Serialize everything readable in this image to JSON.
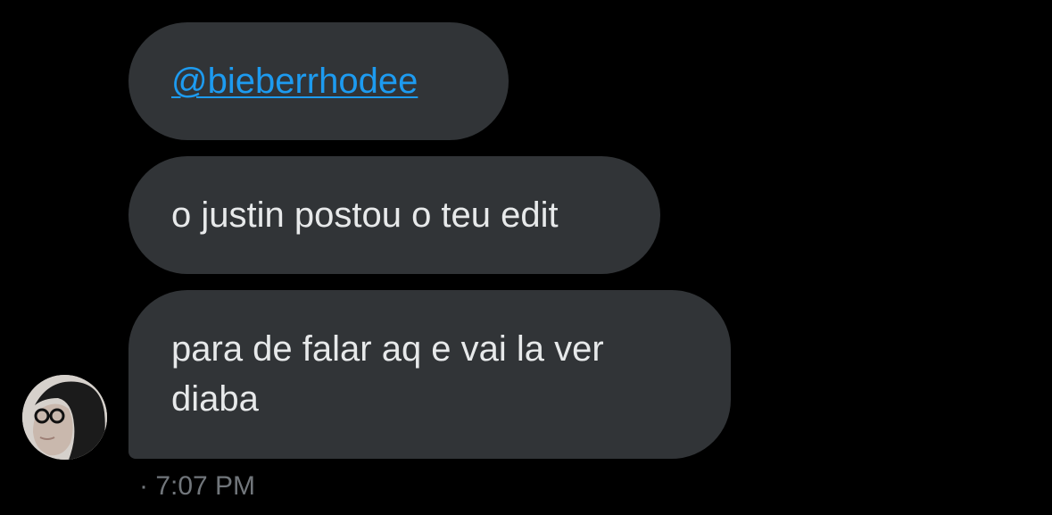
{
  "messages": [
    {
      "mention": "@bieberrhodee"
    },
    {
      "text": "o justin postou o teu edit"
    },
    {
      "text": "para de falar aq e vai la ver\ndiaba"
    }
  ],
  "timestamp": "· 7:07 PM",
  "colors": {
    "background": "#000000",
    "bubble": "#313437",
    "text": "#e7e9ea",
    "link": "#1d9bf0",
    "muted": "#71767b"
  }
}
